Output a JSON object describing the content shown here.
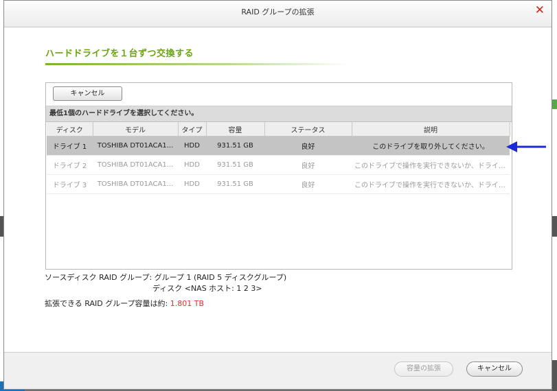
{
  "dialog": {
    "title": "RAID グループの拡張",
    "close_glyph": "✕",
    "step_heading": "ハードドライブを１台ずつ交換する"
  },
  "panel": {
    "toolbar_cancel_label": "キャンセル",
    "hint": "最低1個のハードドライブを選択してください。",
    "columns": [
      "ディスク",
      "モデル",
      "タイプ",
      "容量",
      "ステータス",
      "説明"
    ],
    "rows": [
      {
        "disk": "ドライブ 1",
        "model": "TOSHIBA DT01ACA1...",
        "type": "HDD",
        "capacity": "931.51 GB",
        "status": "良好",
        "description": "このドライブを取り外してください。",
        "selected": true
      },
      {
        "disk": "ドライブ 2",
        "model": "TOSHIBA DT01ACA1...",
        "type": "HDD",
        "capacity": "931.51 GB",
        "status": "良好",
        "description": "このドライブで操作を実行できないか、ドライブ...",
        "selected": false
      },
      {
        "disk": "ドライブ 3",
        "model": "TOSHIBA DT01ACA1...",
        "type": "HDD",
        "capacity": "931.51 GB",
        "status": "良好",
        "description": "このドライブで操作を実行できないか、ドライブ...",
        "selected": false
      }
    ]
  },
  "info": {
    "source_line": "ソースディスク RAID グループ: グループ 1 (RAID 5 ディスクグループ)",
    "disk_line": "ディスク <NAS ホスト: 1 2 3>",
    "capacity_prefix": "拡張できる RAID グループ容量は約: ",
    "capacity_value": "1.801 TB"
  },
  "footer": {
    "expand_label": "容量の拡張",
    "cancel_label": "キャンセル"
  },
  "colors": {
    "heading_green": "#6aa30f",
    "close_red": "#d62020",
    "capacity_red": "#e0302a",
    "annotation_arrow_blue": "#1b2bd6"
  }
}
